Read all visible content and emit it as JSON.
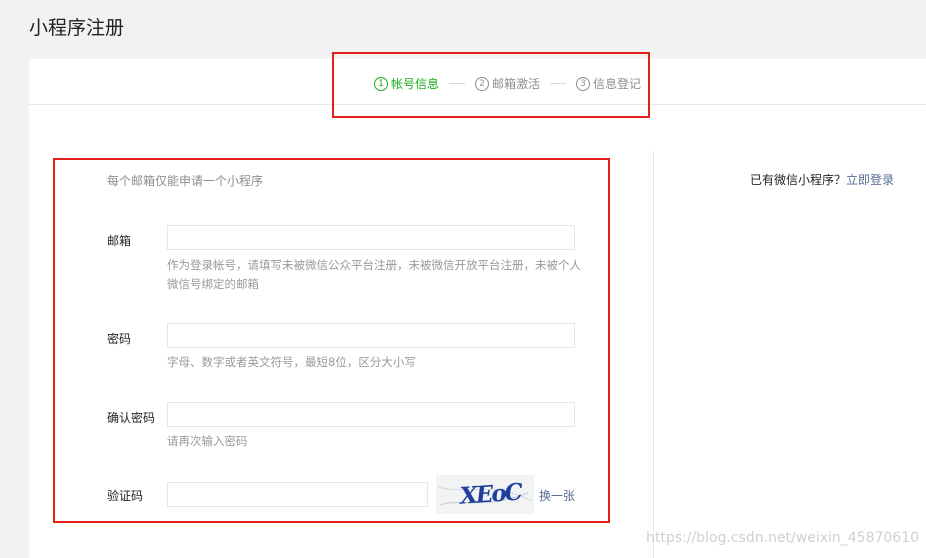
{
  "page": {
    "title": "小程序注册"
  },
  "steps": [
    {
      "num": "1",
      "label": "帐号信息",
      "active": true
    },
    {
      "num": "2",
      "label": "邮箱激活",
      "active": false
    },
    {
      "num": "3",
      "label": "信息登记",
      "active": false
    }
  ],
  "form": {
    "tip": "每个邮箱仅能申请一个小程序",
    "email": {
      "label": "邮箱",
      "value": "",
      "hint": "作为登录帐号，请填写未被微信公众平台注册，未被微信开放平台注册，未被个人微信号绑定的邮箱"
    },
    "password": {
      "label": "密码",
      "value": "",
      "hint": "字母、数字或者英文符号，最短8位，区分大小写"
    },
    "confirm": {
      "label": "确认密码",
      "value": "",
      "hint": "请再次输入密码"
    },
    "captcha": {
      "label": "验证码",
      "value": "",
      "image_text": "XEoC",
      "change_label": "换一张"
    }
  },
  "side": {
    "question": "已有微信小程序？",
    "login_link": "立即登录"
  },
  "watermark": "https://blog.csdn.net/weixin_45870610",
  "colors": {
    "active_step": "#1aad19",
    "link": "#576b95",
    "highlight": "#e5201a"
  }
}
